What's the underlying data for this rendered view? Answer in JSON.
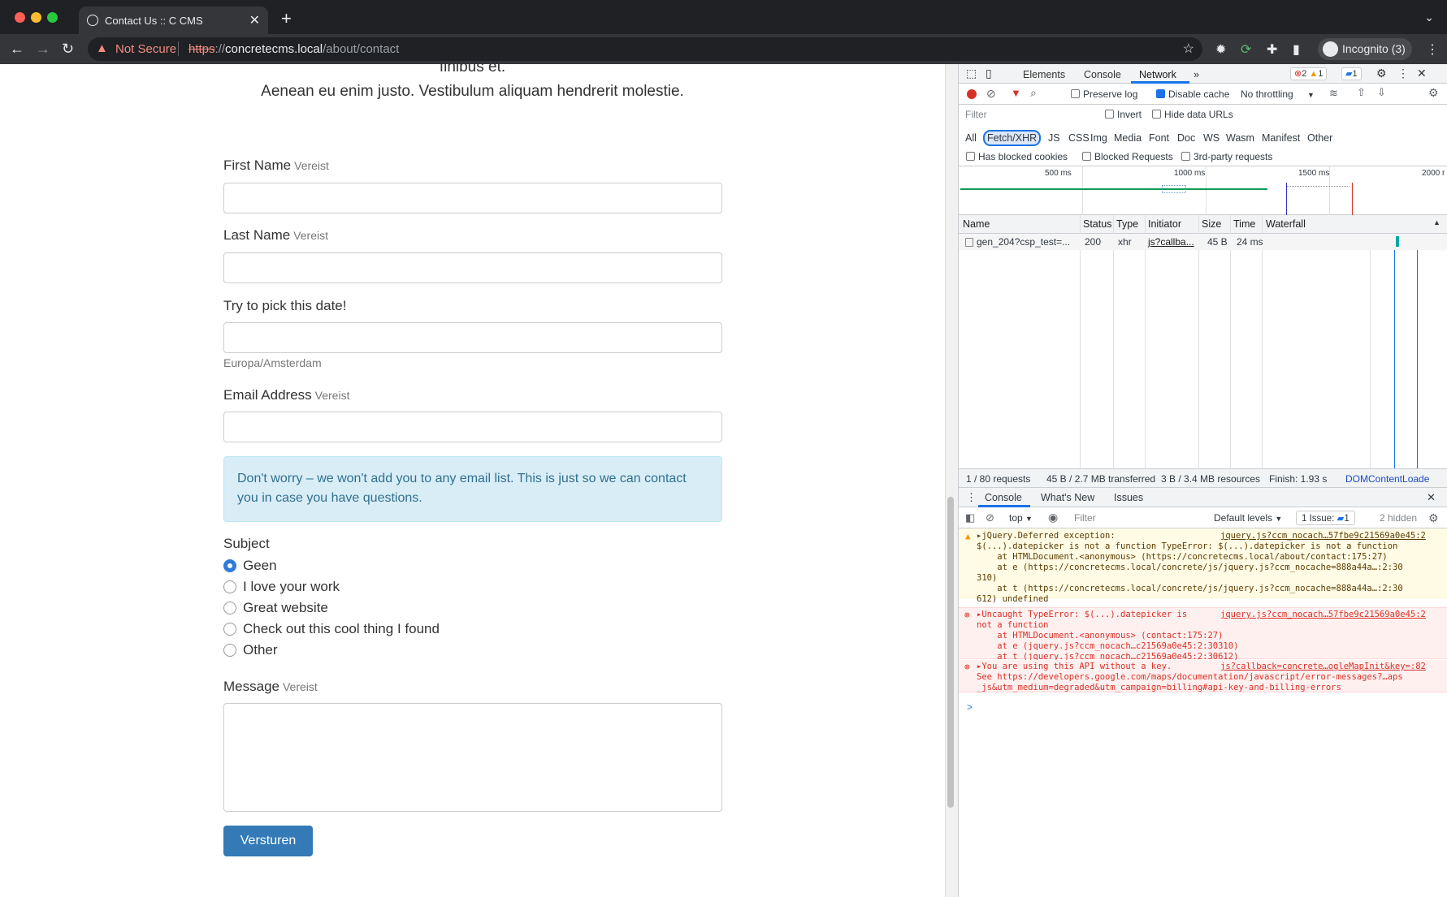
{
  "browser": {
    "tab_title": "Contact Us :: C CMS",
    "security_label": "Not Secure",
    "url_scheme": "https",
    "url_sep": "://",
    "url_host": "concretecms.local",
    "url_path": "/about/contact",
    "profile_label": "Incognito (3)"
  },
  "page": {
    "intro_line1": "finibus et.",
    "intro_line2": "Aenean eu enim justo. Vestibulum aliquam hendrerit molestie.",
    "first_name_label": "First Name",
    "last_name_label": "Last Name",
    "required_label": "Vereist",
    "date_label": "Try to pick this date!",
    "timezone": "Europa/Amsterdam",
    "email_label": "Email Address",
    "info_text": "Don't worry – we won't add you to any email list. This is just so we can contact you in case you have questions.",
    "subject_label": "Subject",
    "subject_options": [
      "Geen",
      "I love your work",
      "Great website",
      "Check out this cool thing I found",
      "Other"
    ],
    "message_label": "Message",
    "submit_label": "Versturen"
  },
  "devtools": {
    "tabs": [
      "Elements",
      "Console",
      "Network"
    ],
    "more_tabs": "»",
    "error_count": "2",
    "warning_count": "1",
    "info_count": "1",
    "preserve_log": "Preserve log",
    "disable_cache": "Disable cache",
    "throttling": "No throttling",
    "filter_placeholder": "Filter",
    "invert": "Invert",
    "hide_data_urls": "Hide data URLs",
    "filter_types": [
      "All",
      "Fetch/XHR",
      "JS",
      "CSS",
      "Img",
      "Media",
      "Font",
      "Doc",
      "WS",
      "Wasm",
      "Manifest",
      "Other"
    ],
    "has_blocked_cookies": "Has blocked cookies",
    "blocked_requests": "Blocked Requests",
    "third_party": "3rd-party requests",
    "timeline_ticks": [
      "500 ms",
      "1000 ms",
      "1500 ms",
      "2000 r"
    ],
    "columns": [
      "Name",
      "Status",
      "Type",
      "Initiator",
      "Size",
      "Time",
      "Waterfall"
    ],
    "rows": [
      {
        "name": "gen_204?csp_test=...",
        "status": "200",
        "type": "xhr",
        "initiator": "js?callba...",
        "size": "45 B",
        "time": "24 ms"
      }
    ],
    "summary": {
      "requests": "1 / 80 requests",
      "transferred": "45 B / 2.7 MB transferred",
      "resources": "3 B / 3.4 MB resources",
      "finish": "Finish: 1.93 s",
      "dcl": "DOMContentLoade"
    },
    "drawer_tabs": [
      "Console",
      "What's New",
      "Issues"
    ],
    "console_context": "top",
    "console_filter_placeholder": "Filter",
    "default_levels": "Default levels",
    "issues_label": "1 Issue:",
    "issues_count": "1",
    "hidden_label": "2 hidden",
    "messages": [
      {
        "level": "warning",
        "lines": [
          "▸jQuery.Deferred exception:",
          "$(...).datepicker is not a function TypeError: $(...).datepicker is not a function",
          "    at HTMLDocument.<anonymous> (https://concretecms.local/about/contact:175:27)",
          "    at e (https://concretecms.local/concrete/js/jquery.js?ccm_nocache=888a44a…:2:30",
          "310)",
          "    at t (https://concretecms.local/concrete/js/jquery.js?ccm_nocache=888a44a…:2:30",
          "612) undefined"
        ],
        "source": "jquery.js?ccm_nocach…57fbe9c21569a0e45:2"
      },
      {
        "level": "error",
        "lines": [
          "▸Uncaught TypeError: $(...).datepicker is",
          "not a function",
          "    at HTMLDocument.<anonymous> (contact:175:27)",
          "    at e (jquery.js?ccm_nocach…c21569a0e45:2:30310)",
          "    at t (jquery.js?ccm_nocach…c21569a0e45:2:30612)"
        ],
        "source": "jquery.js?ccm_nocach…57fbe9c21569a0e45:2"
      },
      {
        "level": "error",
        "lines": [
          "▸You are using this API without a key.",
          "See https://developers.google.com/maps/documentation/javascript/error-messages?…aps",
          "_js&utm_medium=degraded&utm_campaign=billing#api-key-and-billing-errors"
        ],
        "source": "js?callback=concrete…ogleMapInit&key=:82"
      }
    ],
    "prompt": ">"
  },
  "colors": {
    "accent": "#1a73e8",
    "button": "#337ab7",
    "info_bg": "#d9edf7",
    "error_bg": "#fff0f0",
    "warning_bg": "#fffbe5"
  }
}
